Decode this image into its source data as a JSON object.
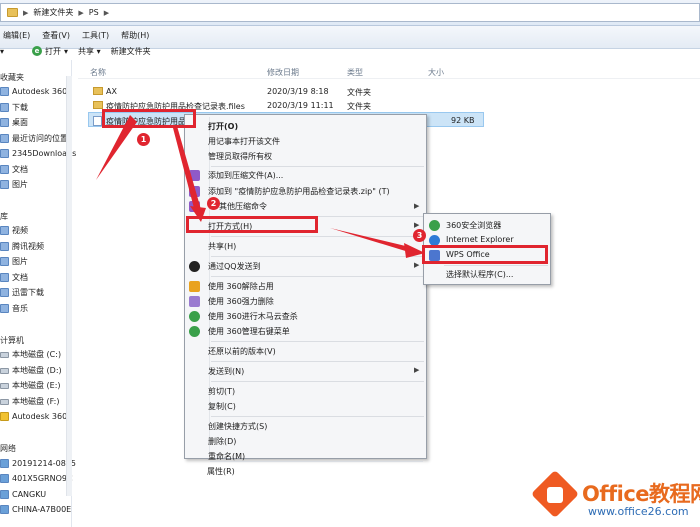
{
  "address": {
    "path": [
      "新建文件夹",
      "PS"
    ]
  },
  "menubar": [
    "编辑(E)",
    "查看(V)",
    "工具(T)",
    "帮助(H)"
  ],
  "cmdbar": {
    "open": "打开",
    "share": "共享",
    "new_folder": "新建文件夹"
  },
  "nav": {
    "favorites_head": "收藏夹",
    "favorites": [
      "Autodesk 360",
      "下载",
      "桌面",
      "最近访问的位置",
      "2345Downloads"
    ],
    "lib_items1": [
      "文档",
      "图片"
    ],
    "library_head": "库",
    "library": [
      "视频",
      "腾讯视频",
      "图片",
      "文档",
      "迅雷下载",
      "音乐"
    ],
    "computer_head": "计算机",
    "drives": [
      "本地磁盘 (C:)",
      "本地磁盘 (D:)",
      "本地磁盘 (E:)",
      "本地磁盘 (F:)",
      "Autodesk 360"
    ],
    "network_head": "网络",
    "network": [
      "20191214-0815",
      "401X5GRNO9C",
      "CANGKU",
      "CHINA-A7B00E"
    ]
  },
  "columns": {
    "name": "名称",
    "modified": "修改日期",
    "type": "类型",
    "size": "大小"
  },
  "files": [
    {
      "name": "AX",
      "modified": "2020/3/19 8:18",
      "type": "文件夹",
      "size": ""
    },
    {
      "name": "疫情防护应急防护用品检查记录表.files",
      "modified": "2020/3/19 11:11",
      "type": "文件夹",
      "size": ""
    },
    {
      "name": "疫情防护应急防护用品",
      "modified": "",
      "type": "",
      "size": "92 KB"
    }
  ],
  "context_menu": {
    "open": "打开(O)",
    "notepad": "用记事本打开该文件",
    "admin": "管理员取得所有权",
    "add_archive": "添加到压缩文件(A)...",
    "add_zip": "添加到 \"疫情防护应急防护用品检查记录表.zip\" (T)",
    "compress_cmd": "其他压缩命令",
    "open_with": "打开方式(H)",
    "share": "共享(H)",
    "qq_send": "通过QQ发送到",
    "unlock360": "使用 360解除占用",
    "force_del360": "使用 360强力删除",
    "trojan360": "使用 360进行木马云查杀",
    "menu360": "使用 360管理右键菜单",
    "restore": "还原以前的版本(V)",
    "send_to": "发送到(N)",
    "cut": "剪切(T)",
    "copy": "复制(C)",
    "shortcut": "创建快捷方式(S)",
    "delete": "删除(D)",
    "rename": "重命名(M)",
    "properties": "属性(R)"
  },
  "submenu": {
    "browser360": "360安全浏览器",
    "ie": "Internet Explorer",
    "wps": "WPS Office",
    "choose": "选择默认程序(C)..."
  },
  "annotations": {
    "step1": "1",
    "step2": "2",
    "step3": "3"
  },
  "watermark": {
    "brand": "Office教程网",
    "url": "www.office26.com"
  },
  "colors": {
    "annotation_red": "#e0252f",
    "selection": "#cce4f7",
    "watermark_orange": "#ef5a22"
  }
}
